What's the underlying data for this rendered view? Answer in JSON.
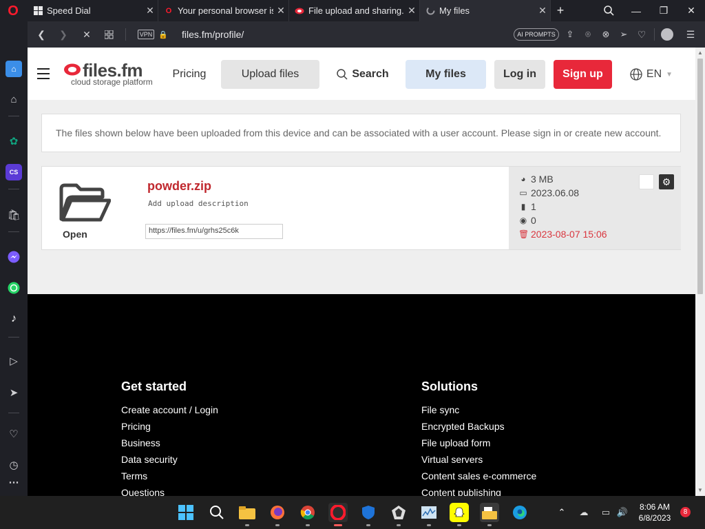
{
  "tabs": [
    {
      "title": "Speed Dial",
      "icon": "speed-dial-icon"
    },
    {
      "title": "Your personal browser is a",
      "icon": "opera-icon"
    },
    {
      "title": "File upload and sharing. L",
      "icon": "filesfm-icon"
    },
    {
      "title": "My files",
      "icon": "loading-icon"
    }
  ],
  "address": {
    "vpn_label": "VPN",
    "url": "files.fm/profile/",
    "ai_prompts": "AI PROMPTS"
  },
  "site": {
    "logo_text": "files.fm",
    "logo_sub": "cloud storage platform",
    "nav": {
      "pricing": "Pricing",
      "upload": "Upload files",
      "search": "Search",
      "my_files": "My files",
      "login": "Log in",
      "signup": "Sign up",
      "lang": "EN"
    },
    "notice": "The files shown below have been uploaded from this device and can be associated with a user account. Please sign in or create new account."
  },
  "file": {
    "open_label": "Open",
    "name": "powder.zip",
    "description_placeholder": "Add upload description",
    "link": "https://files.fm/u/grhs25c6k",
    "size": "3 MB",
    "date": "2023.06.08",
    "count": "1",
    "views": "0",
    "expires": "2023-08-07 15:06"
  },
  "footer": {
    "col1_title": "Get started",
    "col1_links": [
      "Create account / Login",
      "Pricing",
      "Business",
      "Data security",
      "Terms",
      "Questions"
    ],
    "col2_title": "Solutions",
    "col2_links": [
      "File sync",
      "Encrypted Backups",
      "File upload form",
      "Virtual servers",
      "Content sales e-commerce",
      "Content publishing"
    ]
  },
  "taskbar": {
    "time": "8:06 AM",
    "date": "6/8/2023",
    "badge": "8"
  },
  "colors": {
    "brand_red": "#e8283a",
    "my_files_bg": "#dce8f7",
    "expiry_red": "#d9363e"
  }
}
